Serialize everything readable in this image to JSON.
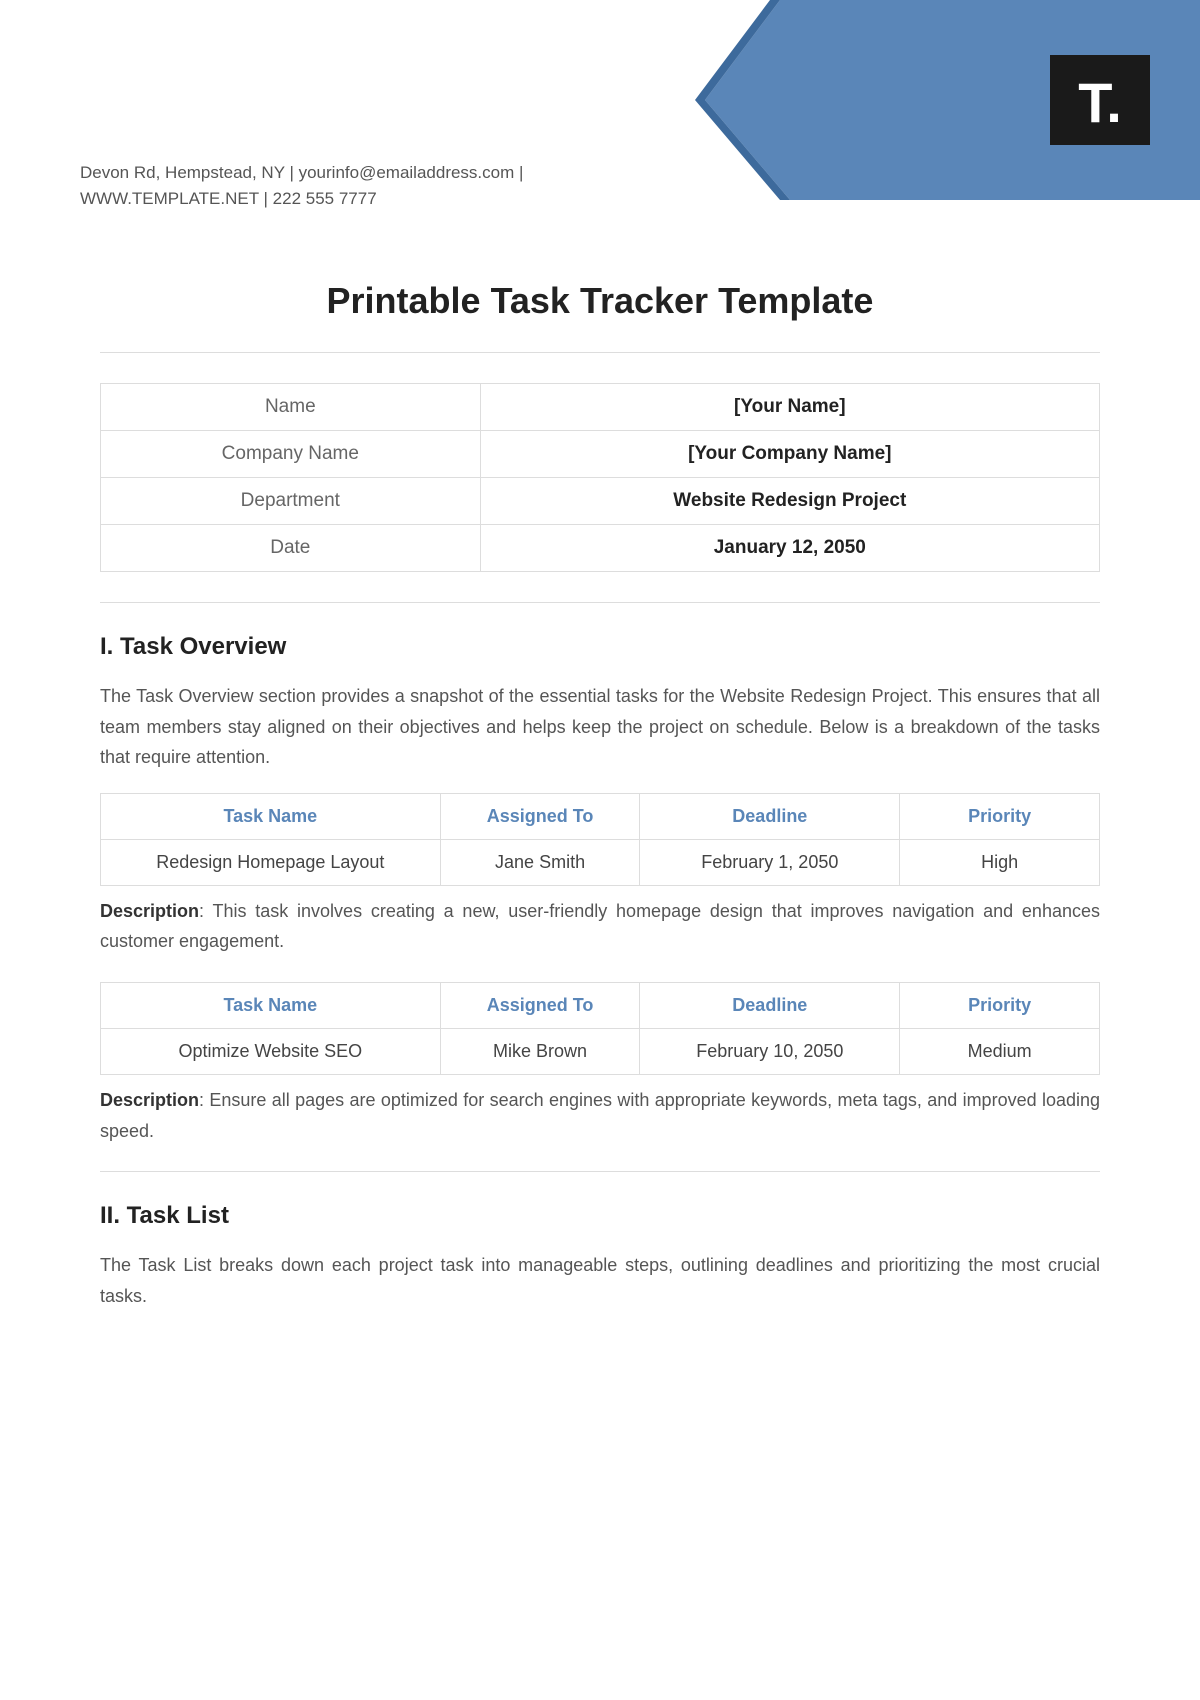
{
  "header": {
    "contact_line1": "Devon Rd, Hempstead, NY | yourinfo@emailaddress.com |",
    "contact_line2": "WWW.TEMPLATE.NET | 222 555 7777",
    "logo_text": "T."
  },
  "title": "Printable Task Tracker Template",
  "info": [
    {
      "label": "Name",
      "value": "[Your Name]"
    },
    {
      "label": "Company Name",
      "value": "[Your Company Name]"
    },
    {
      "label": "Department",
      "value": "Website Redesign Project"
    },
    {
      "label": "Date",
      "value": "January 12, 2050"
    }
  ],
  "section1": {
    "heading": "I. Task Overview",
    "body": "The Task Overview section provides a snapshot of the essential tasks for the Website Redesign Project. This ensures that all team members stay aligned on their objectives and helps keep the project on schedule. Below is a breakdown of the tasks that require attention.",
    "columns": {
      "c1": "Task Name",
      "c2": "Assigned To",
      "c3": "Deadline",
      "c4": "Priority"
    },
    "desc_label": "Description",
    "tasks": [
      {
        "name": "Redesign Homepage Layout",
        "assigned": "Jane Smith",
        "deadline": "February 1, 2050",
        "priority": "High",
        "description": ": This task involves creating a new, user-friendly homepage design that improves navigation and enhances customer engagement."
      },
      {
        "name": "Optimize Website SEO",
        "assigned": "Mike Brown",
        "deadline": "February 10, 2050",
        "priority": "Medium",
        "description": ": Ensure all pages are optimized for search engines with appropriate keywords, meta tags, and improved loading speed."
      }
    ]
  },
  "section2": {
    "heading": "II. Task List",
    "body": "The Task List breaks down each project task into manageable steps, outlining deadlines and prioritizing the most crucial tasks."
  }
}
